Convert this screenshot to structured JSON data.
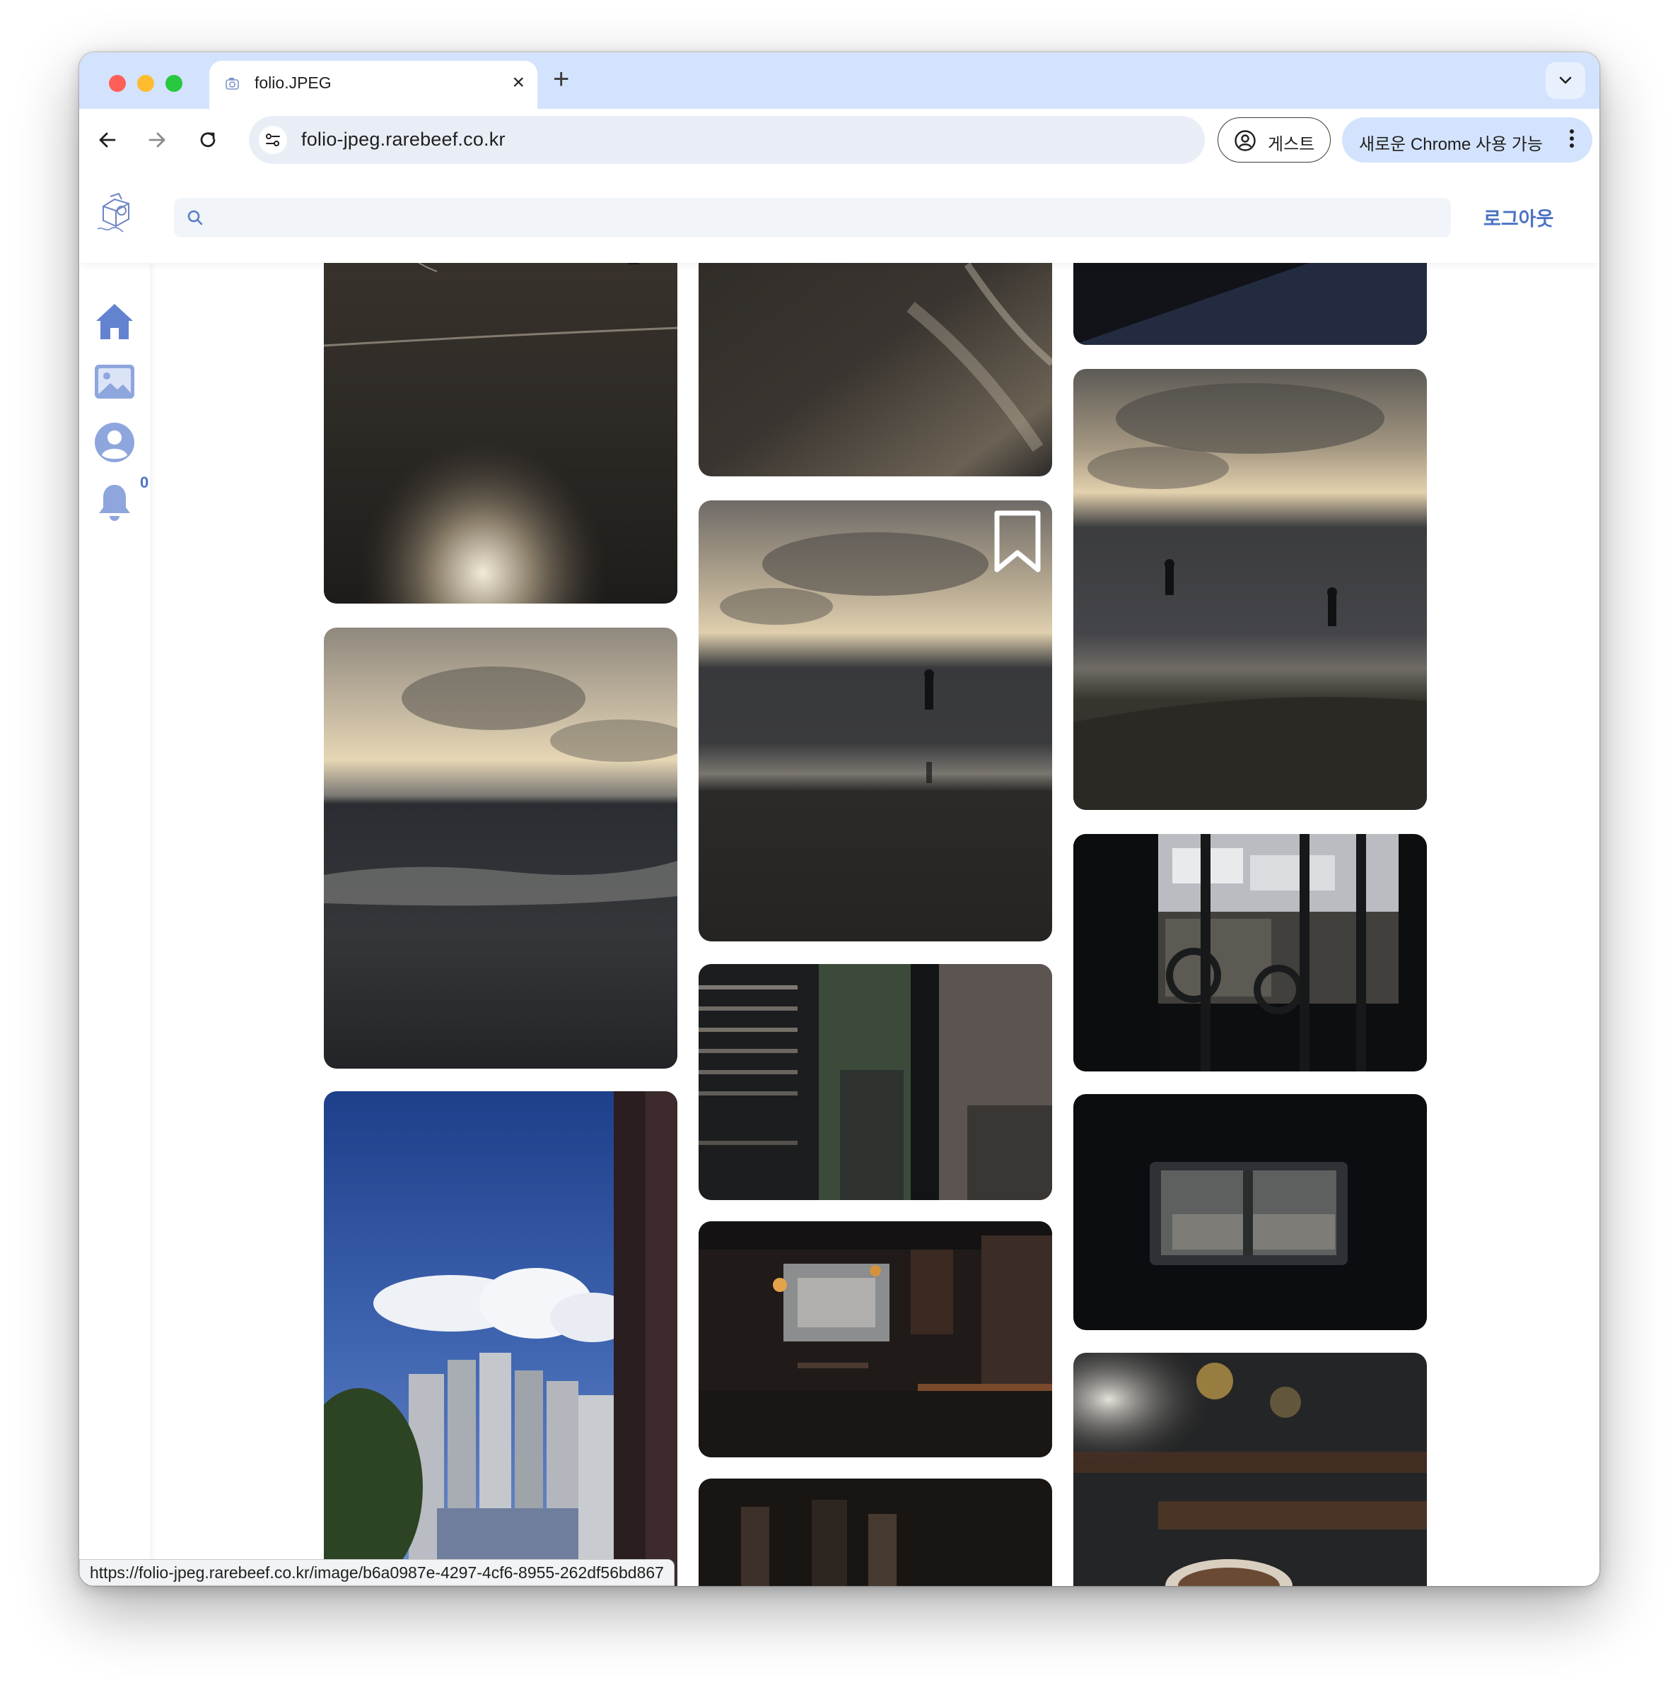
{
  "browser": {
    "tab_title": "folio.JPEG",
    "url": "folio-jpeg.rarebeef.co.kr",
    "guest_label": "게스트",
    "update_label": "새로운 Chrome 사용 가능",
    "status_url": "https://folio-jpeg.rarebeef.co.kr/image/b6a0987e-4297-4cf6-8955-262df56bd867"
  },
  "site": {
    "logo": "folio-jpeg-logo",
    "search_placeholder": "",
    "logout_label": "로그아웃",
    "accent_color": "#4b72c4",
    "sidebar": [
      {
        "name": "home-icon"
      },
      {
        "name": "gallery-icon"
      },
      {
        "name": "profile-icon"
      },
      {
        "name": "bell-icon",
        "badge": "0"
      }
    ]
  },
  "gallery": {
    "columns": [
      {
        "photos": [
          "beach-footsteps-wet-sand",
          "cloudy-sea-waves",
          "blue-sky-apartment-towers"
        ]
      },
      {
        "photos": [
          "wet-sand-reflections",
          "person-in-sea-at-dusk",
          "cafe-window-blinds",
          "dark-pub-interior",
          "dark-shelves"
        ]
      },
      {
        "photos": [
          "dark-night-window",
          "children-playing-on-shore",
          "motorcycle-through-window",
          "framed-view-through-opening",
          "coffee-cup-bokeh"
        ]
      }
    ],
    "bookmark_icon": "bookmark-icon"
  }
}
